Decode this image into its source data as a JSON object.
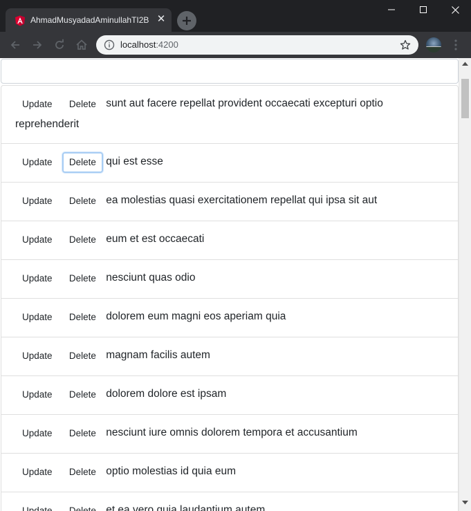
{
  "browser": {
    "tab_title": "AhmadMusyadadAminullahTI2B",
    "url_host": "localhost",
    "url_port": ":4200"
  },
  "search": {
    "value": "",
    "placeholder": ""
  },
  "buttons": {
    "update_label": "Update",
    "delete_label": "Delete"
  },
  "posts": [
    {
      "title": "sunt aut facere repellat provident occaecati excepturi optio reprehenderit"
    },
    {
      "title": "qui est esse"
    },
    {
      "title": "ea molestias quasi exercitationem repellat qui ipsa sit aut"
    },
    {
      "title": "eum et est occaecati"
    },
    {
      "title": "nesciunt quas odio"
    },
    {
      "title": "dolorem eum magni eos aperiam quia"
    },
    {
      "title": "magnam facilis autem"
    },
    {
      "title": "dolorem dolore est ipsam"
    },
    {
      "title": "nesciunt iure omnis dolorem tempora et accusantium"
    },
    {
      "title": "optio molestias id quia eum"
    },
    {
      "title": "et ea vero quia laudantium autem"
    }
  ],
  "focused_delete_index": 1,
  "colors": {
    "angular_red": "#dd0031",
    "focus_ring": "#a8cdf4",
    "chrome_dark": "#202124"
  },
  "icons": [
    "angular-logo-icon",
    "close-icon",
    "plus-icon",
    "minimize-icon",
    "maximize-icon",
    "back-icon",
    "forward-icon",
    "reload-icon",
    "home-icon",
    "info-icon",
    "star-icon",
    "menu-dots-icon"
  ]
}
